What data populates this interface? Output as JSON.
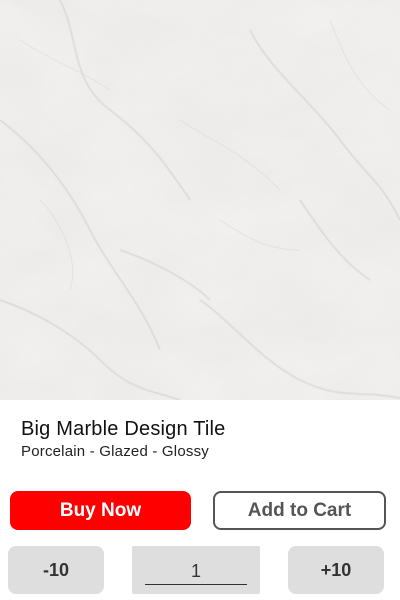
{
  "product": {
    "title": "Big Marble Design Tile",
    "subtitle": "Porcelain - Glazed - Glossy",
    "image": "marble-tile-image"
  },
  "actions": {
    "buy_now_label": "Buy Now",
    "add_to_cart_label": "Add to Cart"
  },
  "quantity": {
    "decrement_label": "-10",
    "value": "1",
    "increment_label": "+10"
  },
  "colors": {
    "buy_now_bg": "#ff0000",
    "add_to_cart_border": "#555555",
    "stepper_bg": "#dedede"
  }
}
